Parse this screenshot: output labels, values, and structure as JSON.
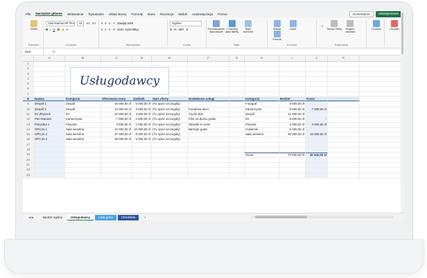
{
  "menu": {
    "tabs": [
      "Plik",
      "Narzędzie główne",
      "Wstawianie",
      "Rysowanie",
      "Układ strony",
      "Formuły",
      "Dane",
      "Recenzja",
      "Widok",
      "Automatyzacja",
      "Pomoc"
    ],
    "comments": "Komentarze",
    "share": "Udostępnianie"
  },
  "ribbon": {
    "paste": "Wklej",
    "clipboard": "Schowek",
    "font_name": "Arial Narrow MT Pro",
    "font_size": "11",
    "font": "Czcionka",
    "wrap": "Zawijaj tekst",
    "merge": "Scal i wyśrodkuj",
    "alignment": "Wyrównanie",
    "num_format": "Ogólne",
    "number": "Liczba",
    "styles": [
      "Formatowanie warunkowe",
      "Formatuj jako tabelę",
      "Style komórki"
    ],
    "styles_label": "Style",
    "cells": [
      "Wstaw",
      "Usuń",
      "Format"
    ],
    "cells_label": "Komórki",
    "editing": [
      "Sortuj i filtruj",
      "Znajdź i zaznacz"
    ],
    "editing_label": "Edytowanie",
    "sensitivity": "Czułość",
    "addins": "Dodatki"
  },
  "formula_bar": {
    "cell": "N15",
    "fx": "fx",
    "content": ""
  },
  "columns": [
    "A",
    "B",
    "C",
    "D",
    "E",
    "F",
    "G",
    "H",
    "I",
    "J",
    "K"
  ],
  "title": "Usługodawcy",
  "headers": {
    "nazwa": "Nazwa",
    "kategoria": "Kategoria",
    "oferowana": "Oferowana cena",
    "zadatek": "Zadatek",
    "opis": "Opis oferty",
    "dodatkowe": "Dodatkowe usługi",
    "kat2": "Kategoria",
    "budzet": "Budżet",
    "koszt": "Koszt"
  },
  "table": [
    [
      "Zespół 1",
      "Zespół",
      "15 000,00 zł",
      "5 000,00 zł",
      "(Tu opisz szczegóły)",
      "-"
    ],
    [
      "Zespół 2",
      "Zespół",
      "12 000,00 zł",
      "3 000,00 zł",
      "(Tu opisz szczegóły)",
      "Fontanna idcer"
    ],
    [
      "DJ Zbyszek",
      "DJ",
      "10 000,00 zł",
      "3 000,00 zł",
      "(Tu opisz szczegóły)",
      "Ciężki dym"
    ],
    [
      "Pan Mariusz",
      "Kamerzysta",
      "7 000,00 zł",
      "2 500,00 zł",
      "(Tu opisz szczegóły)",
      "Film na dysku gratis"
    ],
    [
      "Florystka 1",
      "Florysta",
      "4 500,00 zł",
      "1 000,00 zł",
      "(Tu opisz szczegóły)",
      "Winietki w cenie"
    ],
    [
      "OPCJA 1",
      "Sala weselna",
      "34 000,00 zł",
      "10 000,00 zł",
      "(Tu opisz szczegóły)",
      "Barman gratis"
    ],
    [
      "OPCJA 2",
      "Sala weselna",
      "37 000,00 zł",
      "8 000,00 zł",
      "(Tu opisz szczegóły)",
      "-"
    ],
    [
      "OPCJA 3",
      "Sala weselna",
      "29 000,00 zł",
      "5 000,00 zł",
      "(Tu opisz szczegóły)",
      "-"
    ]
  ],
  "budget": [
    [
      "Fotograf",
      "5 000,00 zł",
      ""
    ],
    [
      "Kamerzysta",
      "8 000,00 zł",
      "7 000,00 zł"
    ],
    [
      "Zespół",
      "11 000,00 zł",
      ""
    ],
    [
      "DJ",
      "8 000,00 zł",
      "-"
    ],
    [
      "Florysta",
      "3 000,00 zł",
      "4 500,00 zł"
    ],
    [
      "Cukiernik",
      "5 000,00 zł",
      ""
    ],
    [
      "Sala weselna",
      "30 000,00 zł",
      "34 000,00 zł"
    ]
  ],
  "sum": {
    "label": "Suma",
    "budget": "70 000,00 zł",
    "cost": "45 500,00 zł"
  },
  "sheets": [
    "Budżet ogólny",
    "Usługodawcy",
    "Lista gości",
    "Checklista"
  ],
  "row_numbers": [
    "1",
    "2",
    "3",
    "4",
    "5",
    "6",
    "7",
    "8",
    "9",
    "10",
    "11",
    "12",
    "13",
    "14",
    "15",
    "16",
    "17",
    "18",
    "19",
    "20",
    "21",
    "22",
    "23"
  ]
}
